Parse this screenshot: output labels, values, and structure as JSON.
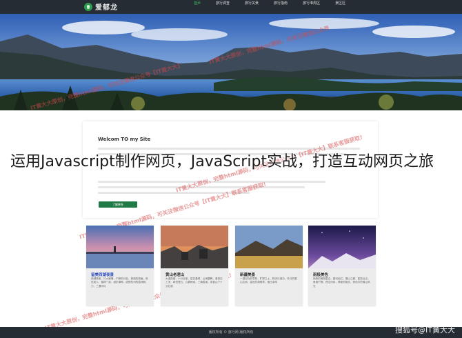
{
  "header": {
    "logo_text": "爱郁龙",
    "nav": [
      "首页",
      "旅行调查",
      "旅行关景",
      "旅行指南",
      "旅行准周区",
      "景区区"
    ],
    "active_index": 0
  },
  "overlay": {
    "headline": "运用Javascript制作网页，JavaScript实战，打造互动网页之旅"
  },
  "watermarks": [
    "IT黄大大原创，完整html源码，可关注微信公众号【IT黄大大】",
    "IT黄大大原创，完整html源码，可关注微信公众号",
    "IT黄大大原创，完整html源码，可关注微信公众号【IT黄大大】联系客服获取!",
    "IT黄大大原创，完整html源码，可关注微信公众号【IT黄大大】联系客服获取!",
    "IT黄大大原创，完整html源码，可关注微信公众号【IT黄大大】联系客服获取!"
  ],
  "intro": {
    "title": "Welcom TO my Site",
    "button_label": "了解更多"
  },
  "features": [
    {
      "title": "留美西湖夜景",
      "desc": "西湖夜景，灯火阑珊，宁静的月色，美丽的湖面，夜色迷人，值得一游，漫步湖畔，感受杭州的独特魅力，三潭印月"
    },
    {
      "title": "黄山老君山",
      "desc": "大漠孤烟，十分壮丽，层峦叠嶂，云海翻腾，清泉石上流，奇松怪石，云雾缭绕，三清胜境，老君山下十分壮观"
    },
    {
      "title": "新疆美景",
      "desc": "一望无际的草原，旷野之上，牧场与湖泊，冬日的雪山壮阔，金色的胡杨林，落日余晖"
    },
    {
      "title": "雨极美色",
      "desc": "雨夜的美丽星空，银河灿烂，雪山之巅，星辰点点，美丽宁静，夜空闪烁，神秘的极光，夜色中的雪山风光"
    }
  ],
  "footer": {
    "copyright": "版权所有 © 旅行网 版权所有",
    "sohu_tag": "搜狐号@IT黄大大"
  }
}
